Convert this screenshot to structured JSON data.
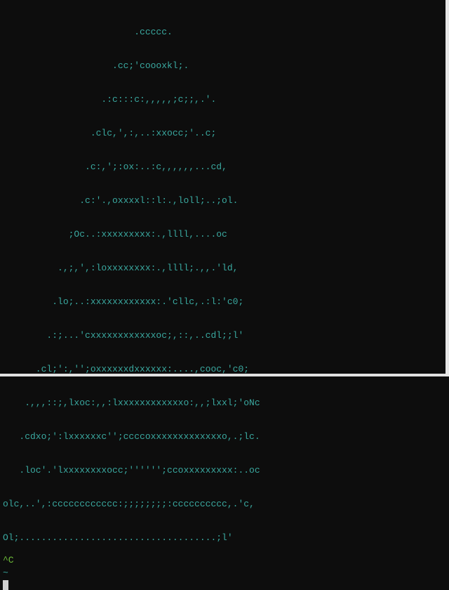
{
  "ascii_art_lines": [
    "                        .ccccc.",
    "                    .cc;'coooxkl;.",
    "                  .:c:::c:,,,,,;c;;,.'.",
    "                .clc,',:,..:xxocc;'..c;",
    "               .c:,';:ox:..:c,,,,,,...cd,",
    "              .c:'.,oxxxxl::l:.,loll;..;ol.",
    "            ;Oc..:xxxxxxxxx:.,llll,....oc",
    "          .,;,',:loxxxxxxxx:.,llll;.,,.'ld,",
    "         .lo;..:xxxxxxxxxxxx:.'cllc,.:l:'c0;",
    "        .:;...'cxxxxxxxxxxxxoc;,::,..cdl;;l'",
    "      .cl;':,'';oxxxxxxdxxxxxx:....,cooc,'c0;",
    "    .,,,::;,lxoc:,,:lxxxxxxxxxxxxo:,,;lxxl;'oNc",
    "   .cdxo;':lxxxxxxc'';ccccoxxxxxxxxxxxxxo,.;lc.",
    "   .loc'.'lxxxxxxxxocc;'''''';ccoxxxxxxxxx:..oc",
    "olc,..',:cccccccccccc:;;;;;;;;:cccccccccc,.'c,",
    "Ol;....................................;l'",
    "^C"
  ],
  "tilde": "~",
  "interrupt_char": "^C"
}
